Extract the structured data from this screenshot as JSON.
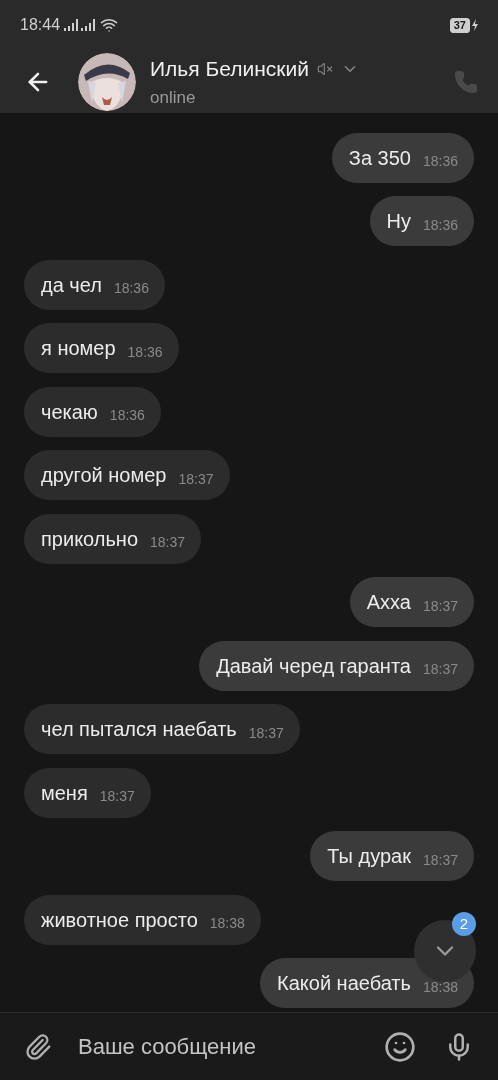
{
  "status_bar": {
    "time": "18:44",
    "battery": "37"
  },
  "header": {
    "name": "Илья Белинский",
    "status": "online",
    "muted": true
  },
  "messages": [
    {
      "text": "За 350",
      "time": "18:36",
      "outgoing": true
    },
    {
      "text": "Ну",
      "time": "18:36",
      "outgoing": true
    },
    {
      "text": "да чел",
      "time": "18:36",
      "outgoing": false
    },
    {
      "text": "я номер",
      "time": "18:36",
      "outgoing": false
    },
    {
      "text": "чекаю",
      "time": "18:36",
      "outgoing": false
    },
    {
      "text": "другой номер",
      "time": "18:37",
      "outgoing": false
    },
    {
      "text": "прикольно",
      "time": "18:37",
      "outgoing": false
    },
    {
      "text": "Ахха",
      "time": "18:37",
      "outgoing": true
    },
    {
      "text": "Давай черед гаранта",
      "time": "18:37",
      "outgoing": true
    },
    {
      "text": "чел пытался наебать",
      "time": "18:37",
      "outgoing": false
    },
    {
      "text": "меня",
      "time": "18:37",
      "outgoing": false
    },
    {
      "text": "Ты дурак",
      "time": "18:37",
      "outgoing": true
    },
    {
      "text": "животное просто",
      "time": "18:38",
      "outgoing": false
    },
    {
      "text": "Какой наебать",
      "time": "18:38",
      "outgoing": true
    }
  ],
  "scroll_button": {
    "badge": "2"
  },
  "composer": {
    "placeholder": "Ваше сообщение"
  }
}
